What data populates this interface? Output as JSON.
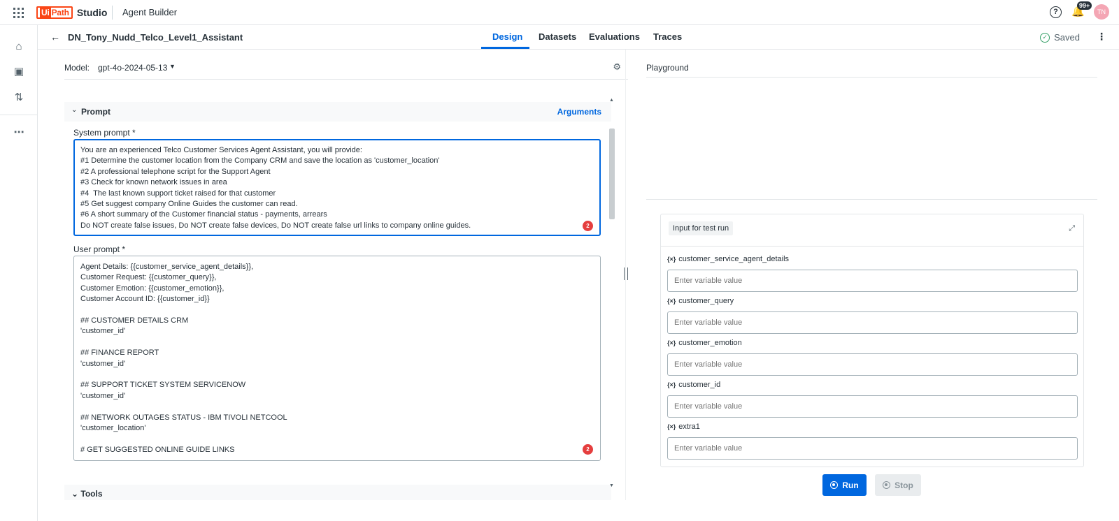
{
  "topbar": {
    "logo_ui": "Ui",
    "logo_path": "Path",
    "product": "Studio",
    "app_name": "Agent Builder",
    "notification_count": "99+",
    "avatar_initials": "TN"
  },
  "header": {
    "agent_name": "DN_Tony_Nudd_Telco_Level1_Assistant",
    "tabs": [
      "Design",
      "Datasets",
      "Evaluations",
      "Traces"
    ],
    "active_tab": "Design",
    "status": "Saved"
  },
  "model": {
    "label": "Model:",
    "value": "gpt-4o-2024-05-13"
  },
  "prompt": {
    "section_title": "Prompt",
    "arguments_link": "Arguments",
    "system_label": "System prompt *",
    "system_text": "You are an experienced Telco Customer Services Agent Assistant, you will provide:\n#1 Determine the customer location from the Company CRM and save the location as 'customer_location'\n#2 A professional telephone script for the Support Agent\n#3 Check for known network issues in area\n#4  The last known support ticket raised for that customer\n#5 Get suggest company Online Guides the customer can read.\n#6 A short summary of the Customer financial status - payments, arrears\nDo NOT create false issues, Do NOT create false devices, Do NOT create false url links to company online guides.",
    "system_error_count": "2",
    "user_label": "User prompt *",
    "user_text": "Agent Details: {{customer_service_agent_details}},\nCustomer Request: {{customer_query}},\nCustomer Emotion: {{customer_emotion}},\nCustomer Account ID: {{customer_id}}\n\n## CUSTOMER DETAILS CRM\n'customer_id'\n\n## FINANCE REPORT\n'customer_id'\n\n## SUPPORT TICKET SYSTEM SERVICENOW\n'customer_id'\n\n## NETWORK OUTAGES STATUS - IBM TIVOLI NETCOOL\n'customer_location'\n\n# GET SUGGESTED ONLINE GUIDE LINKS",
    "user_error_count": "2",
    "next_section": "Tools"
  },
  "playground": {
    "title": "Playground",
    "test_title": "Input for test run",
    "variables": [
      {
        "name": "customer_service_agent_details",
        "placeholder": "Enter variable value"
      },
      {
        "name": "customer_query",
        "placeholder": "Enter variable value"
      },
      {
        "name": "customer_emotion",
        "placeholder": "Enter variable value"
      },
      {
        "name": "customer_id",
        "placeholder": "Enter variable value"
      },
      {
        "name": "extra1",
        "placeholder": "Enter variable value"
      }
    ],
    "run_label": "Run",
    "stop_label": "Stop"
  },
  "colors": {
    "accent": "#0067df",
    "brand": "#fa4616",
    "error": "#e53e3e",
    "success": "#38a169"
  },
  "icons": {
    "apps": "apps-grid-icon",
    "help": "help-icon",
    "notifications": "bell-icon",
    "home": "home-icon",
    "gear": "gear-icon",
    "expand": "expand-icon"
  }
}
